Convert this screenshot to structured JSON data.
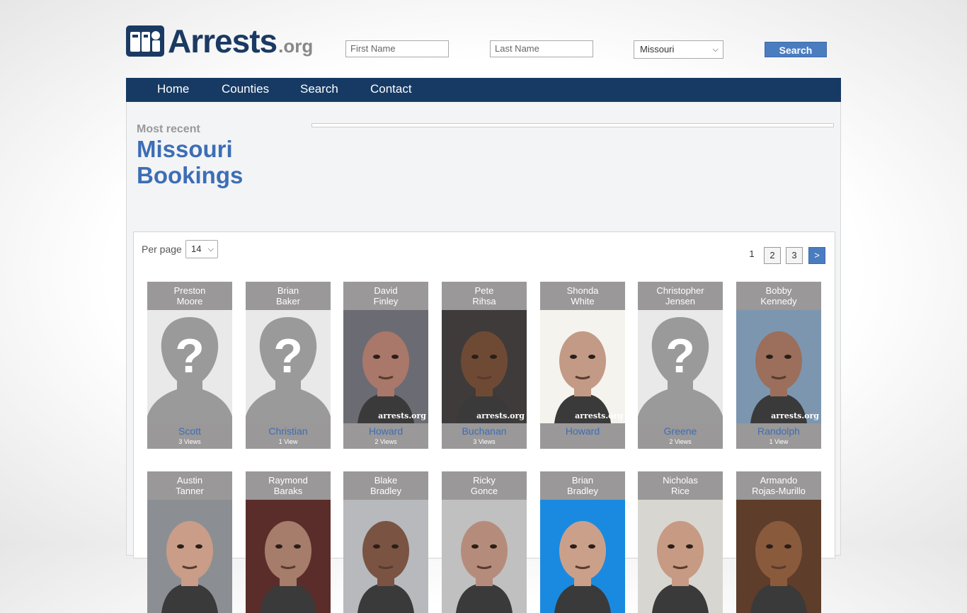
{
  "header": {
    "logo_text": "Arrests",
    "logo_suffix": ".org",
    "first_name_placeholder": "First Name",
    "last_name_placeholder": "Last Name",
    "state_selected": "Missouri",
    "search_label": "Search"
  },
  "nav": {
    "items": [
      "Home",
      "Counties",
      "Search",
      "Contact"
    ]
  },
  "main": {
    "subtitle": "Most recent",
    "title_line1": "Missouri",
    "title_line2": "Bookings"
  },
  "listing": {
    "per_page_label": "Per page",
    "per_page_value": "14",
    "pages": [
      "1",
      "2",
      "3",
      ">"
    ],
    "current_page": "1"
  },
  "cards": [
    {
      "first": "Preston",
      "last": "Moore",
      "county": "Scott",
      "views": "3 Views",
      "photo": "placeholder"
    },
    {
      "first": "Brian",
      "last": "Baker",
      "county": "Christian",
      "views": "1 View",
      "photo": "placeholder"
    },
    {
      "first": "David",
      "last": "Finley",
      "county": "Howard",
      "views": "2 Views",
      "photo": "mugshot"
    },
    {
      "first": "Pete",
      "last": "Rihsa",
      "county": "Buchanan",
      "views": "3 Views",
      "photo": "mugshot"
    },
    {
      "first": "Shonda",
      "last": "White",
      "county": "Howard",
      "views": "",
      "photo": "mugshot"
    },
    {
      "first": "Christopher",
      "last": "Jensen",
      "county": "Greene",
      "views": "2 Views",
      "photo": "placeholder"
    },
    {
      "first": "Bobby",
      "last": "Kennedy",
      "county": "Randolph",
      "views": "1 View",
      "photo": "mugshot"
    },
    {
      "first": "Austin",
      "last": "Tanner",
      "county": "",
      "views": "",
      "photo": "mugshot"
    },
    {
      "first": "Raymond",
      "last": "Baraks",
      "county": "",
      "views": "",
      "photo": "mugshot"
    },
    {
      "first": "Blake",
      "last": "Bradley",
      "county": "",
      "views": "",
      "photo": "mugshot"
    },
    {
      "first": "Ricky",
      "last": "Gonce",
      "county": "",
      "views": "",
      "photo": "mugshot"
    },
    {
      "first": "Brian",
      "last": "Bradley",
      "county": "",
      "views": "",
      "photo": "mugshot"
    },
    {
      "first": "Nicholas",
      "last": "Rice",
      "county": "",
      "views": "",
      "photo": "mugshot"
    },
    {
      "first": "Armando",
      "last": "Rojas-Murillo",
      "county": "",
      "views": "",
      "photo": "mugshot"
    }
  ],
  "watermark": "arrests.org",
  "colors": {
    "brand": "#1b3a63",
    "nav": "#163a64",
    "link": "#3d6eb5",
    "accent": "#4a7cc0"
  },
  "icons": [
    "logo-badge-icon",
    "silhouette-placeholder-icon",
    "chevron-down-icon"
  ]
}
